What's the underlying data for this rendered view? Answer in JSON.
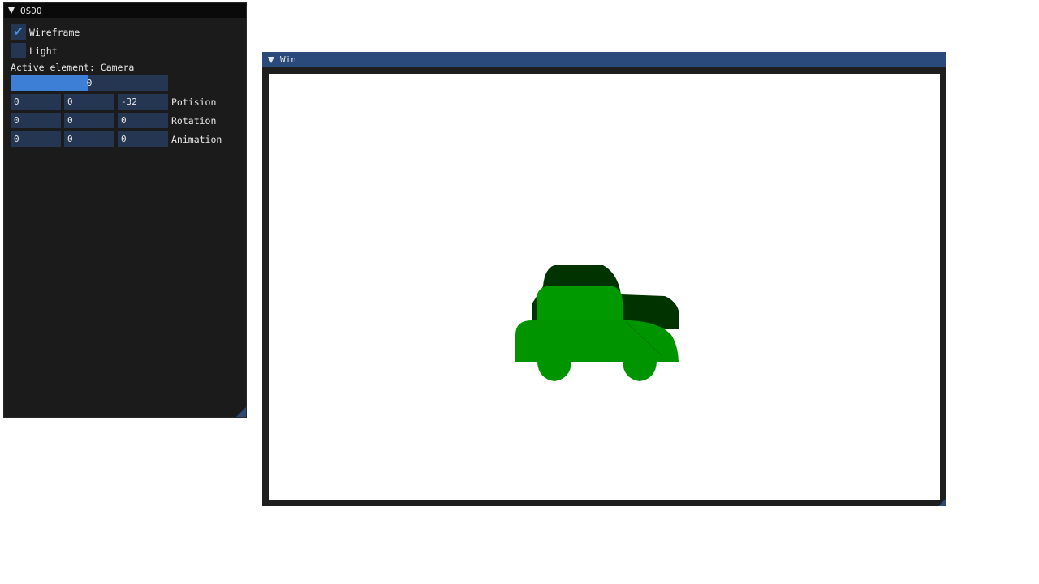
{
  "osdo": {
    "title": "OSDO",
    "wireframe": {
      "label": "Wireframe",
      "checked": true
    },
    "light": {
      "label": "Light",
      "checked": false
    },
    "active_element": "Active element: Camera",
    "slider": {
      "value": "0",
      "fill_fraction": 0.49
    },
    "position": {
      "x": "0",
      "y": "0",
      "z": "-32",
      "label": "Potision"
    },
    "rotation": {
      "x": "0",
      "y": "0",
      "z": "0",
      "label": "Rotation"
    },
    "animation": {
      "x": "0",
      "y": "0",
      "z": "0",
      "label": "Animation"
    }
  },
  "win": {
    "title": "Win"
  },
  "colors": {
    "panel_bg": "#1b1b1b",
    "titlebar_active": "#294a7a",
    "widget_bg": "#243652",
    "accent": "#3d7fd6",
    "car_front": "#009400",
    "car_dark": "#003300"
  }
}
